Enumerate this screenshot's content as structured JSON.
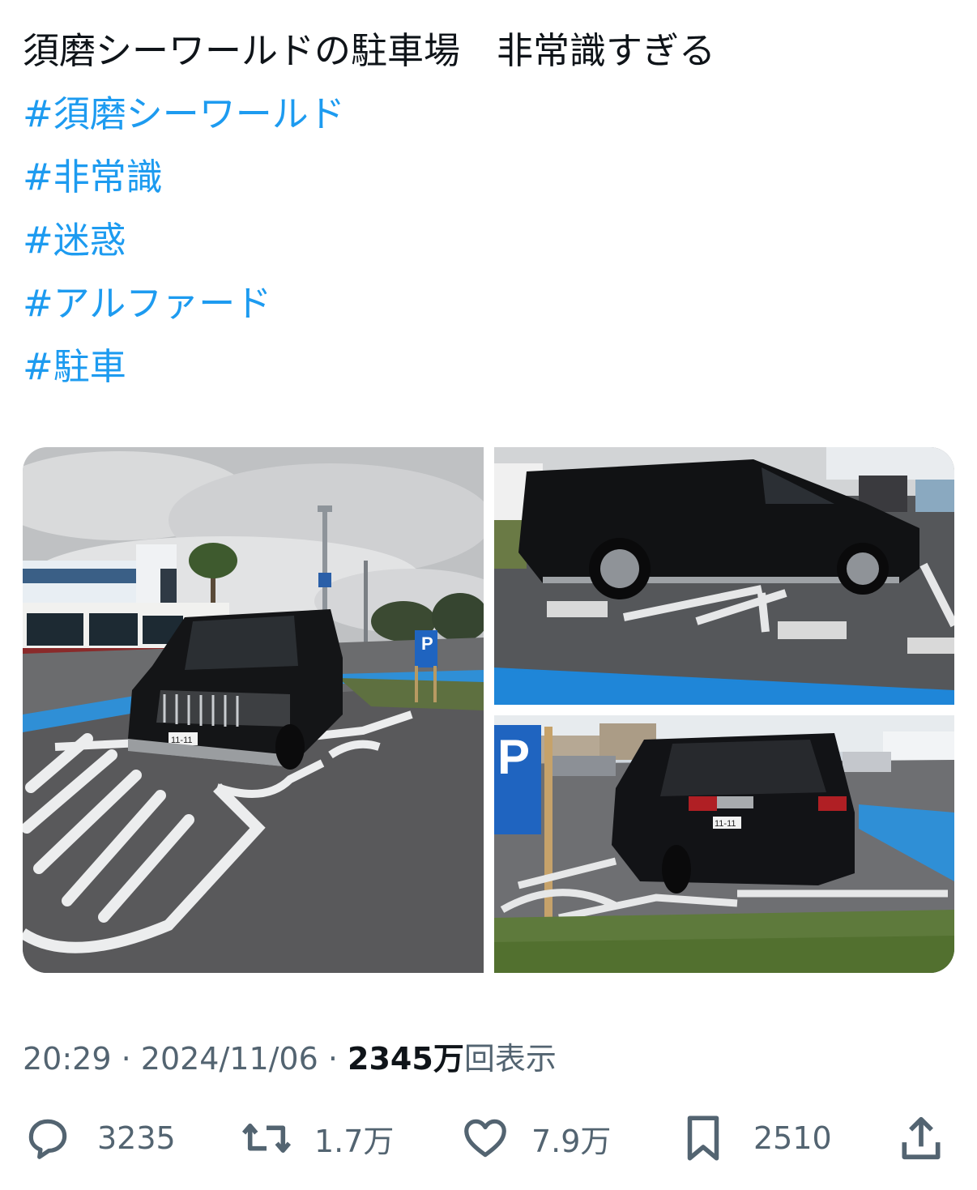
{
  "tweet": {
    "text": "須磨シーワールドの駐車場　非常識すぎる",
    "hashtags": [
      "#須磨シーワールド",
      "#非常識",
      "#迷惑",
      "#アルファード",
      "#駐車"
    ]
  },
  "media": {
    "photos": [
      {
        "description": "black minivan parked diagonally across two disabled parking spaces, buses and building in background"
      },
      {
        "description": "side view of black minivan over striped accessible space"
      },
      {
        "description": "rear view of black minivan next to accessible parking sign"
      }
    ],
    "sign_letter": "P",
    "plate_text": "11-11"
  },
  "meta": {
    "time": "20:29",
    "sep1": " · ",
    "date": "2024/11/06",
    "sep2": " · ",
    "views_number": "2345",
    "views_unit": "万",
    "views_label": "回表示"
  },
  "actions": {
    "reply_count": "3235",
    "retweet_count": "1.7万",
    "like_count": "7.9万",
    "bookmark_count": "2510"
  },
  "colors": {
    "hashtag": "#1d9bf0",
    "text": "#0f1419",
    "muted": "#536471"
  }
}
